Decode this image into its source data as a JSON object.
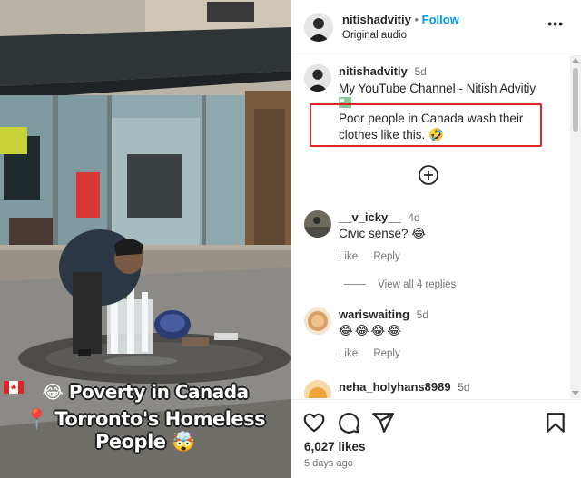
{
  "media": {
    "caption_line1": "Poverty in Canada",
    "caption_line2": "Torronto's Homeless People",
    "caption_emoji1": "😂",
    "caption_emoji2": "📍",
    "caption_emoji3": "🤯"
  },
  "header": {
    "username": "nitishadvitiy",
    "separator": "•",
    "follow_label": "Follow",
    "subtitle": "Original audio",
    "more_label": "•••"
  },
  "post": {
    "username": "nitishadvitiy",
    "time": "5d",
    "line1": "My YouTube Channel - Nitish Advitiy",
    "line2": "Poor people in Canada wash their",
    "line3": "clothes like this.",
    "line3_emoji": "🤣",
    "highlight_color": "#e0252a"
  },
  "load_more_icon": "plus-circle-icon",
  "comments": [
    {
      "username": "__v_icky__",
      "time": "4d",
      "text": "Civic sense?",
      "emoji": "😂",
      "like_label": "Like",
      "reply_label": "Reply",
      "view_replies": "View all 4 replies"
    },
    {
      "username": "wariswaiting",
      "time": "5d",
      "text": "",
      "emoji": "😂😂😂😂",
      "like_label": "Like",
      "reply_label": "Reply"
    },
    {
      "username": "neha_holyhans8989",
      "time": "5d"
    }
  ],
  "footer": {
    "likes": "6,027 likes",
    "ago": "5 days ago",
    "icons": [
      "heart-icon",
      "comment-icon",
      "share-icon",
      "bookmark-icon"
    ]
  },
  "colors": {
    "accent": "#0095f6",
    "text": "#262626",
    "muted": "#737373"
  }
}
